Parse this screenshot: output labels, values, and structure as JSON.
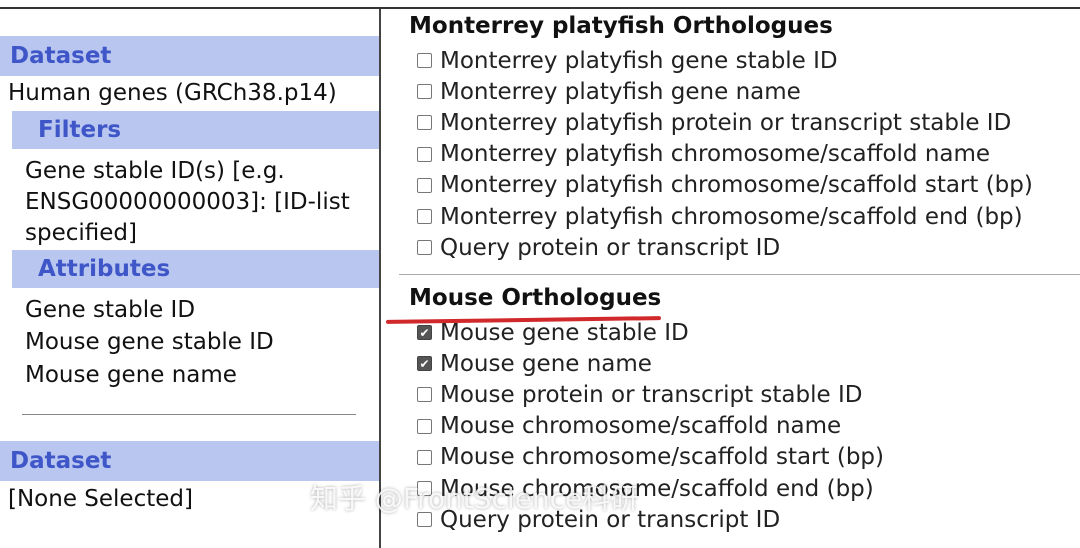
{
  "sidebar": {
    "dataset_heading": "Dataset",
    "dataset_value": "Human genes (GRCh38.p14)",
    "filters_heading": "Filters",
    "filter_lines": [
      "Gene stable ID(s) [e.g.",
      "ENSG00000000003]: [ID-list",
      "specified]"
    ],
    "attributes_heading": "Attributes",
    "attribute_items": [
      "Gene stable ID",
      "Mouse gene stable ID",
      "Mouse gene name"
    ],
    "dataset2_heading": "Dataset",
    "dataset2_value": "[None Selected]"
  },
  "main": {
    "platyfish": {
      "title": "Monterrey platyfish Orthologues",
      "options": [
        {
          "label": "Monterrey platyfish gene stable ID",
          "checked": false
        },
        {
          "label": "Monterrey platyfish gene name",
          "checked": false
        },
        {
          "label": "Monterrey platyfish protein or transcript stable ID",
          "checked": false
        },
        {
          "label": "Monterrey platyfish chromosome/scaffold name",
          "checked": false
        },
        {
          "label": "Monterrey platyfish chromosome/scaffold start (bp)",
          "checked": false
        },
        {
          "label": "Monterrey platyfish chromosome/scaffold end (bp)",
          "checked": false
        },
        {
          "label": "Query protein or transcript ID",
          "checked": false
        }
      ]
    },
    "mouse": {
      "title": "Mouse Orthologues",
      "options": [
        {
          "label": "Mouse gene stable ID",
          "checked": true
        },
        {
          "label": "Mouse gene name",
          "checked": true
        },
        {
          "label": "Mouse protein or transcript stable ID",
          "checked": false
        },
        {
          "label": "Mouse chromosome/scaffold name",
          "checked": false
        },
        {
          "label": "Mouse chromosome/scaffold start (bp)",
          "checked": false
        },
        {
          "label": "Mouse chromosome/scaffold end (bp)",
          "checked": false
        },
        {
          "label": "Query protein or transcript ID",
          "checked": false
        }
      ]
    }
  },
  "watermark": "知乎 @FrontScience科研",
  "colors": {
    "bar_bg": "#b9c6ef",
    "bar_text": "#3e56c8",
    "annotation_red": "#d0282b"
  }
}
